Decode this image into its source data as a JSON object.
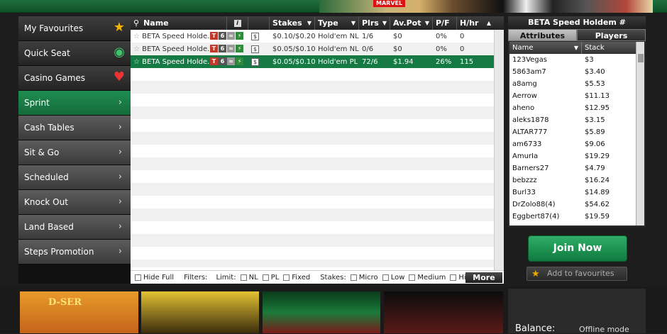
{
  "banner": {
    "marvel": "MARVEL"
  },
  "sidebar": {
    "items": [
      {
        "label": "My Favourites",
        "icon": "star-icon"
      },
      {
        "label": "Quick Seat",
        "icon": "chips-icon"
      },
      {
        "label": "Casino Games",
        "icon": "card-suits-icon"
      },
      {
        "label": "Sprint",
        "icon": "chevron-right-icon"
      },
      {
        "label": "Cash Tables",
        "icon": "chevron-right-icon"
      },
      {
        "label": "Sit & Go",
        "icon": "chevron-right-icon"
      },
      {
        "label": "Scheduled",
        "icon": "chevron-right-icon"
      },
      {
        "label": "Knock Out",
        "icon": "chevron-right-icon"
      },
      {
        "label": "Land Based",
        "icon": "chevron-right-icon"
      },
      {
        "label": "Steps Promotion",
        "icon": "chevron-right-icon"
      }
    ]
  },
  "table": {
    "headers": {
      "name": "Name",
      "info": "i",
      "stakes": "Stakes",
      "type": "Type",
      "plrs": "Plrs",
      "avpot": "Av.Pot",
      "pf": "P/F",
      "hhr": "H/hr"
    },
    "rows": [
      {
        "name": "BETA Speed Holde...",
        "stakes": "$0.10/$0.20",
        "type": "Hold'em NL",
        "plrs": "1/6",
        "avpot": "$0",
        "pf": "0%",
        "hhr": "0"
      },
      {
        "name": "BETA Speed Holde...",
        "stakes": "$0.05/$0.10",
        "type": "Hold'em NL",
        "plrs": "0/6",
        "avpot": "$0",
        "pf": "0%",
        "hhr": "0"
      },
      {
        "name": "BETA Speed Holde...",
        "stakes": "$0.05/$0.10",
        "type": "Hold'em PL",
        "plrs": "72/6",
        "avpot": "$1.94",
        "pf": "26%",
        "hhr": "115"
      }
    ],
    "badges": {
      "t": "T",
      "six": "6",
      "lightning": "⚡",
      "dollar": "$"
    }
  },
  "filters": {
    "hide_full": "Hide Full",
    "filters_label": "Filters:",
    "limit_label": "Limit:",
    "nl": "NL",
    "pl": "PL",
    "fixed": "Fixed",
    "stakes_label": "Stakes:",
    "micro": "Micro",
    "low": "Low",
    "medium": "Medium",
    "high": "High",
    "more": "More"
  },
  "right_panel": {
    "title": "BETA Speed Holdem #",
    "tabs": [
      "Attributes",
      "Players"
    ],
    "col_name": "Name",
    "col_stack": "Stack",
    "players": [
      {
        "name": "123Vegas",
        "stack": "$3"
      },
      {
        "name": "5863am7",
        "stack": "$3.40"
      },
      {
        "name": "a8amg",
        "stack": "$5.53"
      },
      {
        "name": "Aerrow",
        "stack": "$11.13"
      },
      {
        "name": "aheno",
        "stack": "$12.95"
      },
      {
        "name": "aleks1878",
        "stack": "$3.15"
      },
      {
        "name": "ALTAR777",
        "stack": "$5.89"
      },
      {
        "name": "am6733",
        "stack": "$9.06"
      },
      {
        "name": "AmurIa",
        "stack": "$19.29"
      },
      {
        "name": "Barners27",
        "stack": "$4.79"
      },
      {
        "name": "bebzzz",
        "stack": "$16.24"
      },
      {
        "name": "Burl33",
        "stack": "$14.89"
      },
      {
        "name": "DrZolo88(4)",
        "stack": "$54.62"
      },
      {
        "name": "Eggbert87(4)",
        "stack": "$19.59"
      }
    ],
    "join": "Join Now",
    "favourites": "Add to favourites"
  },
  "bottom": {
    "balance_label": "Balance:",
    "balance_value": "Offline mode",
    "game_title": "D-SER"
  }
}
